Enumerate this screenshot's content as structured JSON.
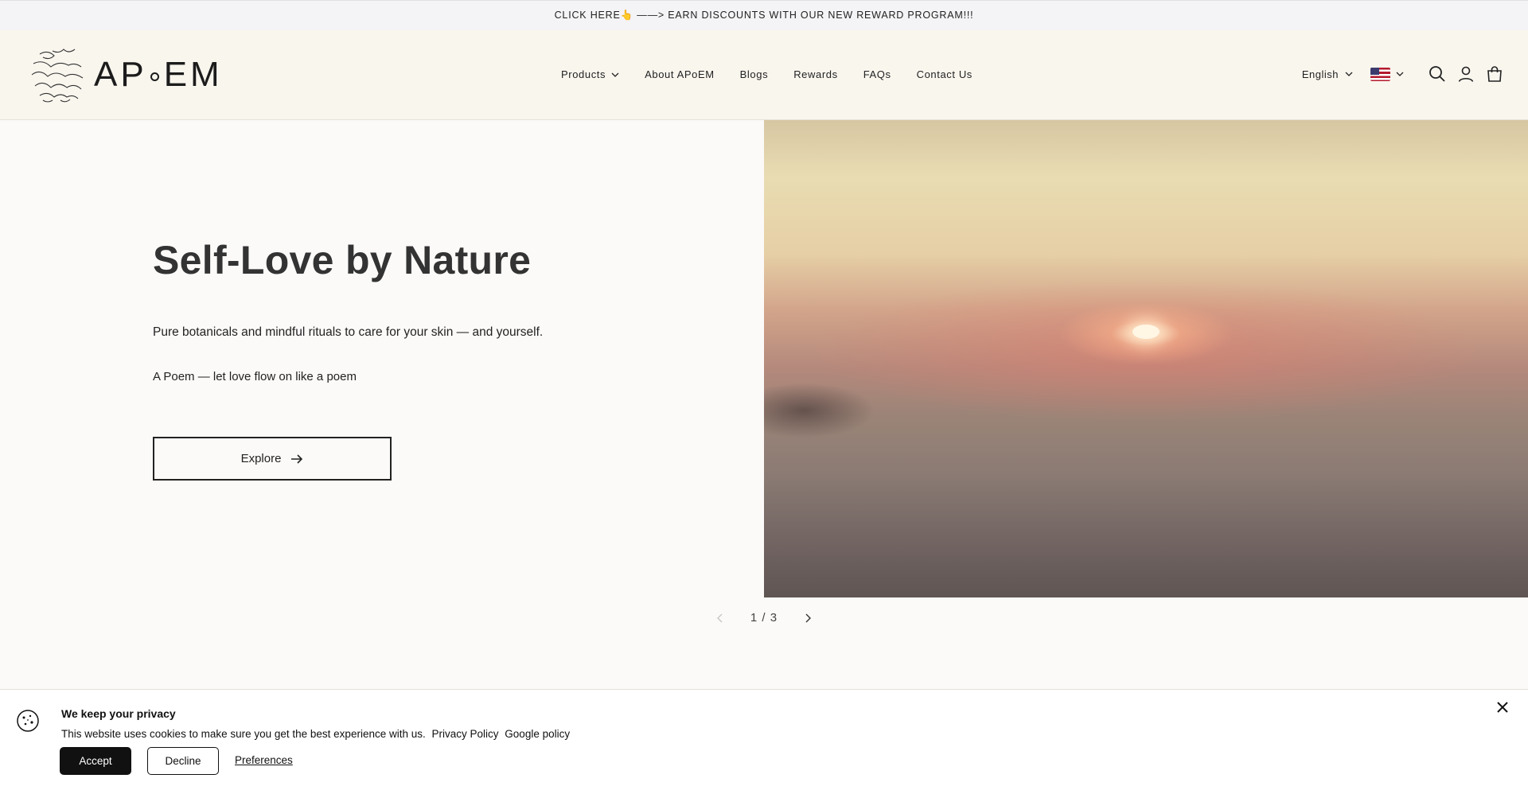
{
  "announcement": {
    "text": "CLICK HERE👆 ——> EARN DISCOUNTS WITH OUR NEW REWARD PROGRAM!!!"
  },
  "header": {
    "logo_text": "AP",
    "logo_text_end": "EM",
    "nav": [
      {
        "label": "Products",
        "has_dropdown": true
      },
      {
        "label": "About APoEM"
      },
      {
        "label": "Blogs"
      },
      {
        "label": "Rewards"
      },
      {
        "label": "FAQs"
      },
      {
        "label": "Contact Us"
      }
    ],
    "language": "English",
    "icons": [
      "search-icon",
      "account-icon",
      "cart-icon"
    ]
  },
  "hero": {
    "title": "Self-Love by Nature",
    "text1": "Pure botanicals and mindful rituals to care for your skin — and yourself.",
    "text2": "A Poem — let love flow on like a poem",
    "button_label": "Explore",
    "slide_counter": "1 / 3"
  },
  "cookie": {
    "title": "We keep your privacy",
    "text": "This website uses cookies to make sure you get the best experience with us.",
    "link_privacy": "Privacy Policy",
    "link_google": "Google policy",
    "accept": "Accept",
    "decline": "Decline",
    "preferences": "Preferences"
  },
  "colors": {
    "header_bg": "#f9f6ee",
    "page_bg": "#fcfaf8",
    "accent_dark": "#111111"
  }
}
